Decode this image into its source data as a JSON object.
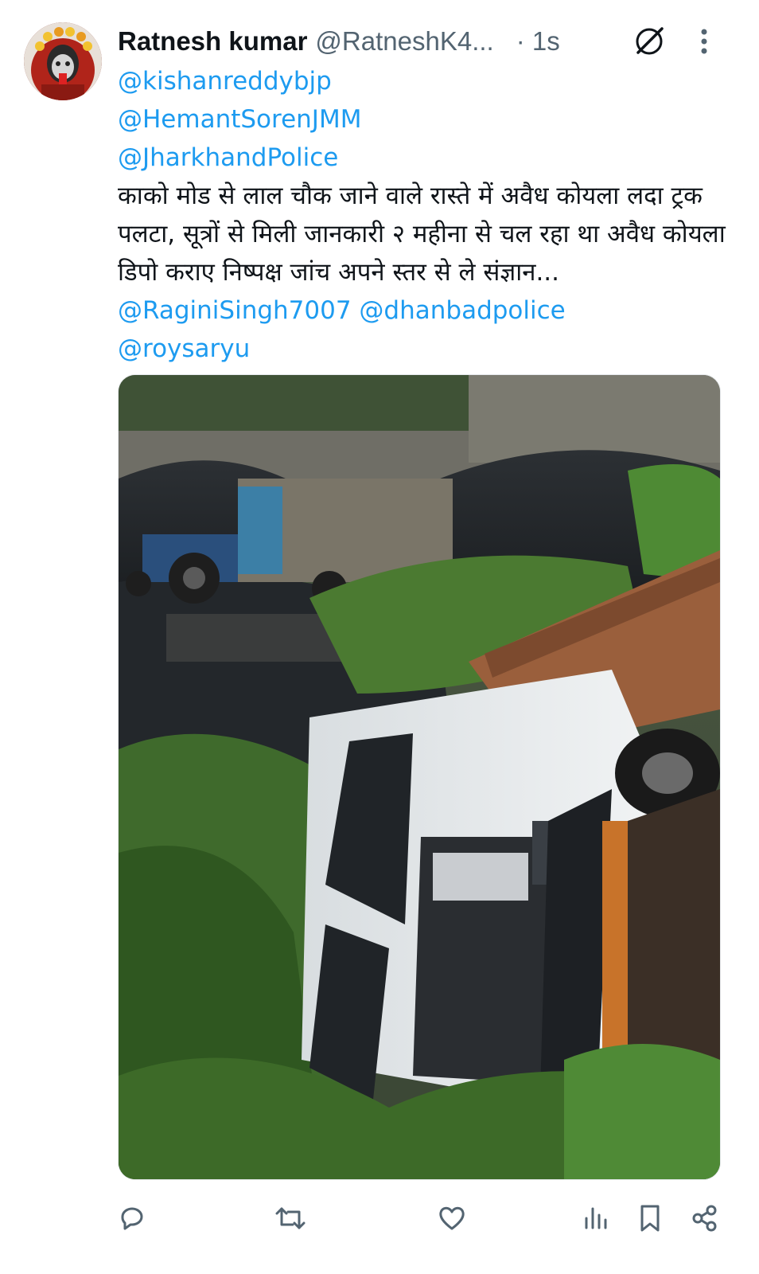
{
  "tweet": {
    "author_name": "Ratnesh kumar",
    "author_handle": "@RatneshK4...",
    "time": "· 1s",
    "mentions_top": [
      "@kishanreddybjp",
      "@HemantSorenJMM",
      "@JharkhandPolice"
    ],
    "body_text": "काको मोड से लाल चौक जाने वाले रास्ते में अवैध कोयला लदा ट्रक पलटा, सूत्रों से मिली जानकारी २ महीना से चल रहा था अवैध कोयला डिपो कराए निष्पक्ष जांच अपने स्तर से ले संज्ञान...",
    "mentions_inline": [
      "@RaginiSingh7007",
      "@dhanbadpolice"
    ],
    "mention_last": "@roysaryu"
  },
  "icons": {
    "grok": "grok-icon",
    "more": "more-vertical-icon",
    "reply": "reply-icon",
    "retweet": "retweet-icon",
    "like": "like-icon",
    "views": "views-icon",
    "bookmark": "bookmark-icon",
    "share": "share-icon"
  },
  "colors": {
    "link": "#1d9bf0",
    "text": "#0f1419",
    "muted": "#536471"
  }
}
